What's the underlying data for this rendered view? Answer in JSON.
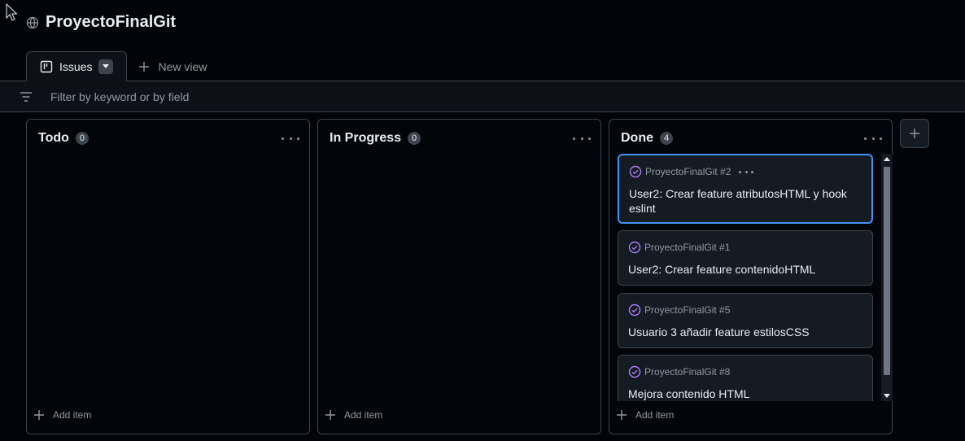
{
  "project": {
    "title": "ProyectoFinalGit",
    "visibility_icon": "globe-icon"
  },
  "tabs": {
    "active_label": "Issues",
    "new_view_label": "New view"
  },
  "filter": {
    "placeholder": "Filter by keyword or by field"
  },
  "columns": [
    {
      "title": "Todo",
      "count": "0",
      "add_label": "Add item"
    },
    {
      "title": "In Progress",
      "count": "0",
      "add_label": "Add item"
    },
    {
      "title": "Done",
      "count": "4",
      "add_label": "Add item"
    }
  ],
  "done_cards": [
    {
      "ref": "ProyectoFinalGit #2",
      "title": "User2: Crear feature atributosHTML y hook eslint"
    },
    {
      "ref": "ProyectoFinalGit #1",
      "title": "User2: Crear feature contenidoHTML"
    },
    {
      "ref": "ProyectoFinalGit #5",
      "title": "Usuario 3 añadir feature estilosCSS"
    },
    {
      "ref": "ProyectoFinalGit #8",
      "title": "Mejora contenido HTML"
    }
  ],
  "colors": {
    "background": "#010409",
    "card": "#151b23",
    "border": "#3d444d",
    "accent_selected": "#4493f8",
    "done_icon": "#ab7df8",
    "muted_text": "#9198a1"
  }
}
